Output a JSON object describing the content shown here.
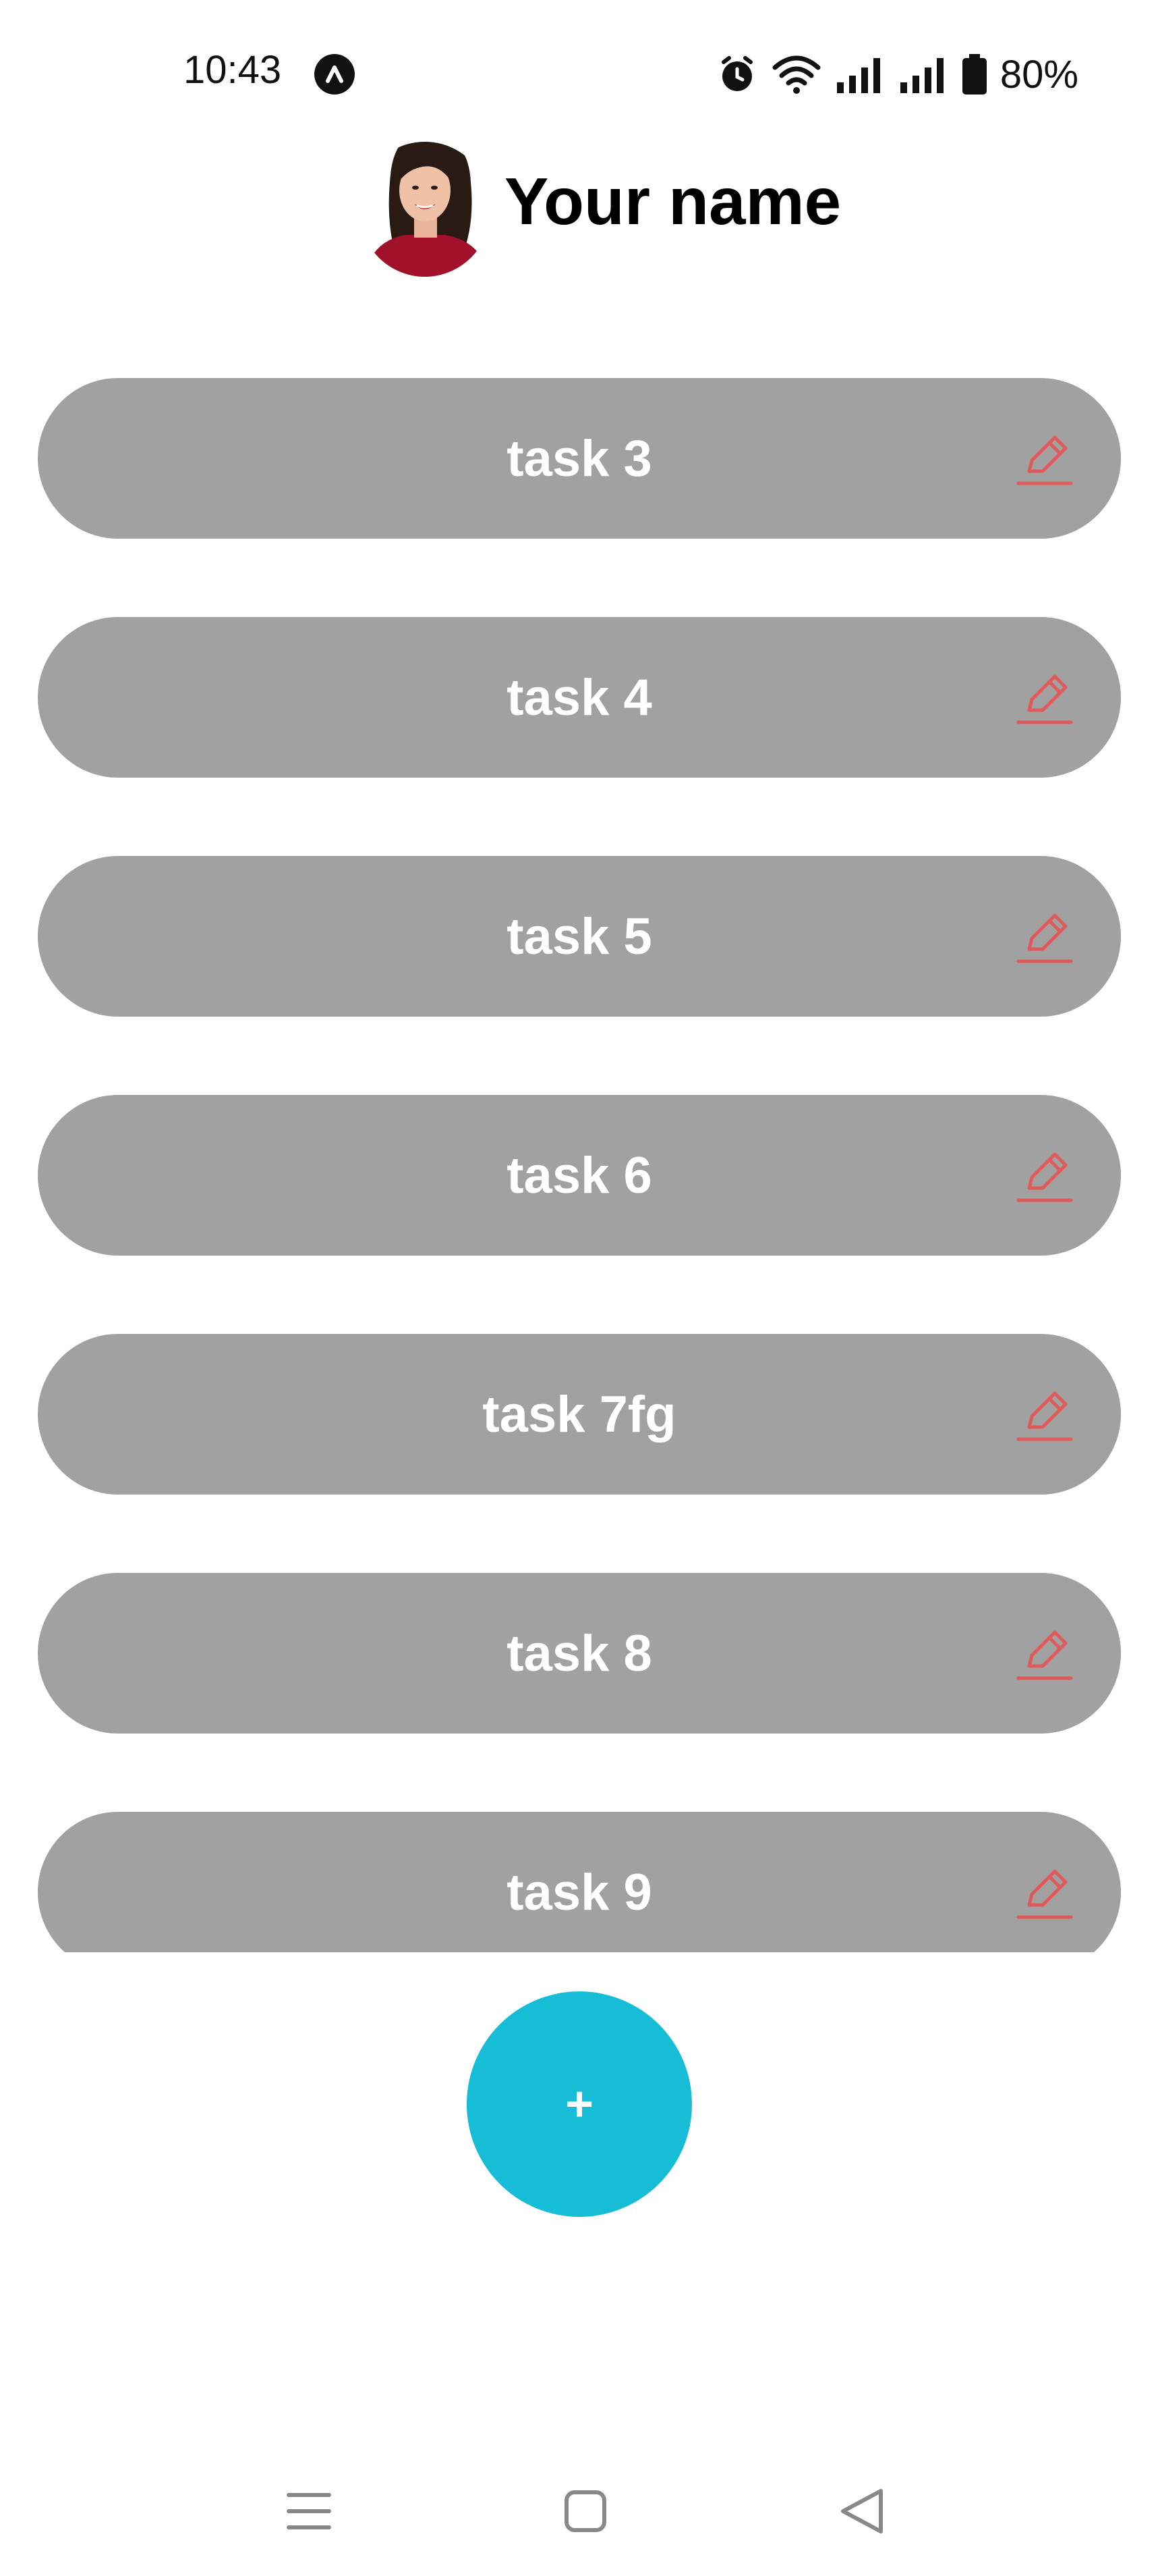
{
  "status_bar": {
    "time": "10:43",
    "battery": "80%",
    "icons": [
      "app-notification-icon",
      "alarm-icon",
      "wifi-icon",
      "signal-icon",
      "signal-icon",
      "battery-icon"
    ]
  },
  "profile": {
    "name": "Your name",
    "avatar_icon": "avatar"
  },
  "tasks": [
    {
      "label": "task 3"
    },
    {
      "label": "task 4"
    },
    {
      "label": "task 5"
    },
    {
      "label": "task 6"
    },
    {
      "label": "task 7fg"
    },
    {
      "label": "task 8"
    },
    {
      "label": "task 9"
    }
  ],
  "fab": {
    "label": "+"
  },
  "colors": {
    "task_bg": "#a1a1a1",
    "edit_icon": "#e05a5a",
    "fab_bg": "#17bcd6"
  },
  "nav_bar": {
    "icons": [
      "menu-icon",
      "home-icon",
      "back-icon"
    ]
  }
}
